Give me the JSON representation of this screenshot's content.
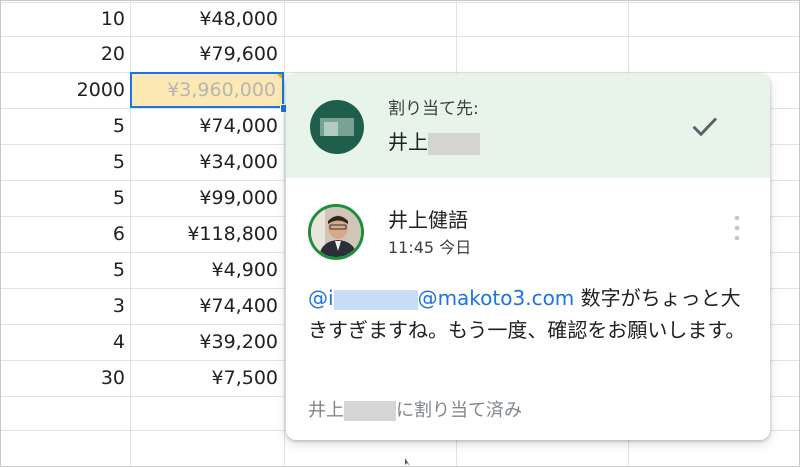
{
  "sheet": {
    "rows": [
      {
        "qty": "10",
        "price": "¥48,000"
      },
      {
        "qty": "20",
        "price": "¥79,600"
      },
      {
        "qty": "2000",
        "price": "¥3,960,000"
      },
      {
        "qty": "5",
        "price": "¥74,000"
      },
      {
        "qty": "5",
        "price": "¥34,000"
      },
      {
        "qty": "5",
        "price": "¥99,000"
      },
      {
        "qty": "6",
        "price": "¥118,800"
      },
      {
        "qty": "5",
        "price": "¥4,900"
      },
      {
        "qty": "3",
        "price": "¥74,400"
      },
      {
        "qty": "4",
        "price": "¥39,200"
      },
      {
        "qty": "30",
        "price": "¥7,500"
      }
    ]
  },
  "comment": {
    "assign_label": "割り当て先:",
    "assignee_visible": "井上",
    "author_name": "井上健語",
    "time": "11:45 今日",
    "mention_prefix": "@i",
    "mention_domain": "@makoto3.com",
    "body_text": " 数字がちょっと大きすぎますね。もう一度、確認をお願いします。",
    "assigned_note_prefix": "井上",
    "assigned_note_suffix": "に割り当て済み",
    "icons": {
      "done": "check-icon",
      "more": "more-vert-icon"
    }
  },
  "colors": {
    "selection": "#1a73e8",
    "selected_fill": "#fce8b2",
    "assign_bar": "#e6f4ea",
    "link": "#1a73e8"
  }
}
